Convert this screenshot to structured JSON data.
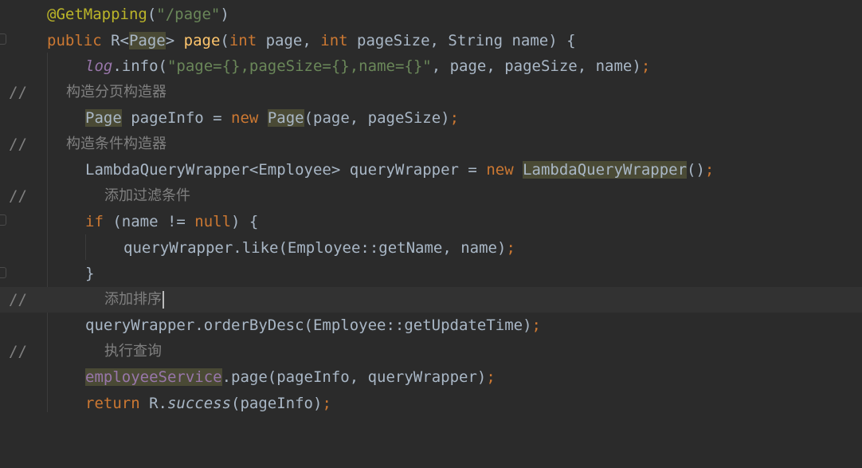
{
  "editor": {
    "lines": [
      {
        "t1": "@GetMapping",
        "t2": "(",
        "t3": "\"/page\"",
        "t4": ")"
      },
      {
        "t1": "public",
        "t2": " R<",
        "t3": "Page",
        "t4": "> ",
        "t5": "page",
        "t6": "(",
        "t7": "int",
        "t8": " page, ",
        "t9": "int",
        "t10": " pageSize, String name) {"
      },
      {
        "t1": "log",
        "t2": ".info(",
        "t3": "\"page={},pageSize={},name={}\"",
        "t4": ", page, pageSize, name)",
        "t5": ";"
      },
      {
        "slash": "//",
        "t1": "构造分页构造器"
      },
      {
        "t1": "Page",
        "t2": " pageInfo = ",
        "t3": "new",
        "t4": " ",
        "t5": "Page",
        "t6": "(page, pageSize)",
        "t7": ";"
      },
      {
        "slash": "//",
        "t1": "构造条件构造器"
      },
      {
        "t1": "LambdaQueryWrapper<Employee> queryWrapper = ",
        "t2": "new",
        "t3": " ",
        "t4": "LambdaQueryWrapper",
        "t5": "()",
        "t6": ";"
      },
      {
        "slash": "//",
        "t1": "添加过滤条件"
      },
      {
        "t1": "if",
        "t2": " (name != ",
        "t3": "null",
        "t4": ") {"
      },
      {
        "t1": "queryWrapper.like(Employee::getName, name)",
        "t2": ";"
      },
      {
        "t1": "}"
      },
      {
        "slash": "//",
        "t1": "添加排序"
      },
      {
        "t1": "queryWrapper.orderByDesc(Employee::getUpdateTime)",
        "t2": ";"
      },
      {
        "slash": "//",
        "t1": "执行查询"
      },
      {
        "t1": "employeeService",
        "t2": ".page(pageInfo, queryWrapper)",
        "t3": ";"
      },
      {
        "t1": "return",
        "t2": " R.",
        "t3": "success",
        "t4": "(pageInfo)",
        "t5": ";"
      }
    ]
  },
  "colors": {
    "background": "#2b2b2b",
    "keyword": "#cc7832",
    "annotation": "#bbb529",
    "string": "#6a8759",
    "method": "#ffc66d",
    "field": "#9876aa",
    "comment": "#808080",
    "default": "#a9b7c6"
  }
}
